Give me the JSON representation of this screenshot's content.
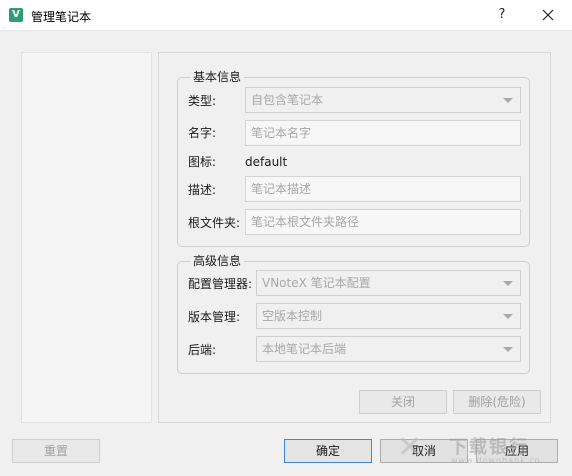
{
  "window": {
    "title": "管理笔记本",
    "help_label": "?",
    "app_icon_letter": "V"
  },
  "basic": {
    "title": "基本信息",
    "type_label": "类型:",
    "type_value": "自包含笔记本",
    "name_label": "名字:",
    "name_placeholder": "笔记本名字",
    "icon_label": "图标:",
    "icon_value": "default",
    "desc_label": "描述:",
    "desc_placeholder": "笔记本描述",
    "root_label": "根文件夹:",
    "root_placeholder": "笔记本根文件夹路径"
  },
  "advanced": {
    "title": "高级信息",
    "config_label": "配置管理器:",
    "config_value": "VNoteX 笔记本配置",
    "version_label": "版本管理:",
    "version_value": "空版本控制",
    "backend_label": "后端:",
    "backend_value": "本地笔记本后端"
  },
  "actions": {
    "close_label": "关闭",
    "delete_label": "删除(危险)"
  },
  "footer": {
    "reset_label": "重置",
    "ok_label": "确定",
    "cancel_label": "取消",
    "apply_label": "应用"
  },
  "watermark": {
    "symbol": "✕",
    "text_cn": "下载银行",
    "text_en": "www.downbank.cn"
  },
  "colors": {
    "accent": "#3c8ad8",
    "app_icon": "#2e9e72"
  }
}
